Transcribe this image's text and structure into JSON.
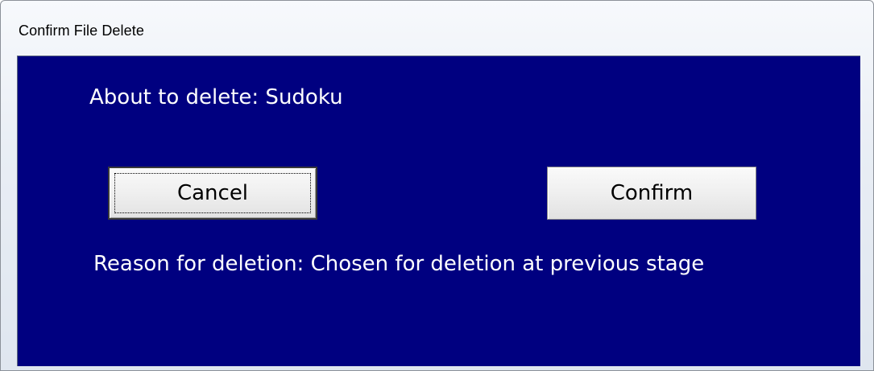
{
  "window": {
    "title": "Confirm File Delete"
  },
  "dialog": {
    "about_text": "About to delete: Sudoku",
    "reason_text": "Reason for deletion: Chosen for deletion at previous stage",
    "cancel_label": "Cancel",
    "confirm_label": "Confirm"
  },
  "colors": {
    "client_background": "#000080",
    "text": "#ffffff"
  }
}
